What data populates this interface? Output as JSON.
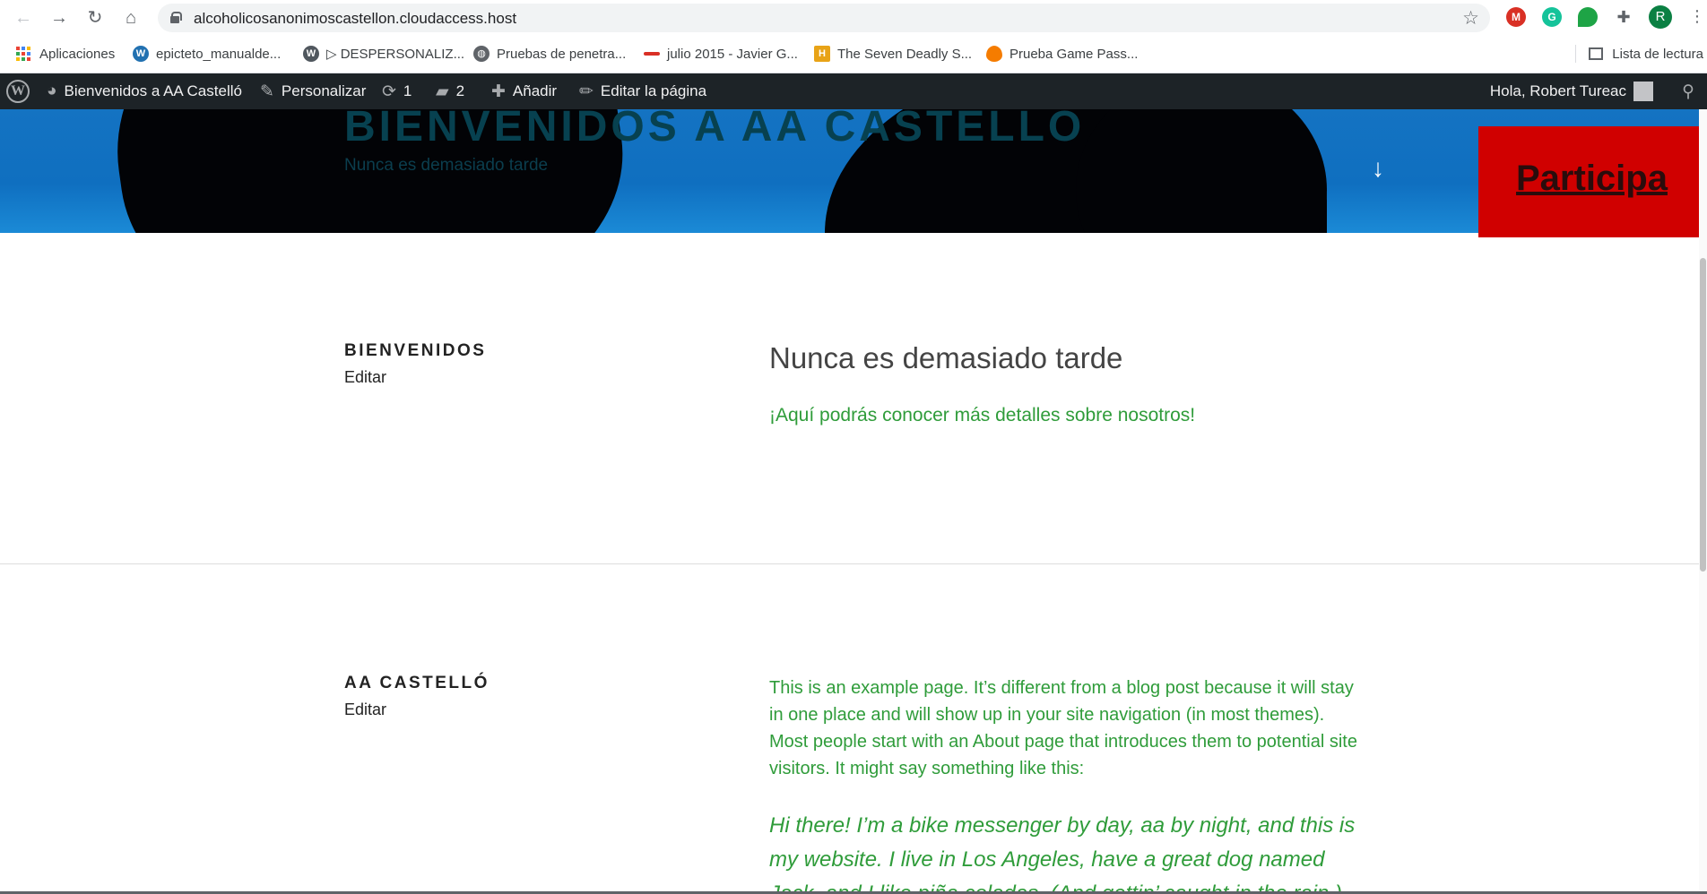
{
  "browser": {
    "url": "alcoholicosanonimoscastellon.cloudaccess.host",
    "profile_initial": "R",
    "bookmarks": [
      {
        "label": "Aplicaciones",
        "icon": "apps-grid-icon"
      },
      {
        "label": "epicteto_manualde...",
        "icon": "wordpress-icon"
      },
      {
        "label": "▷ DESPERSONALIZ...",
        "icon": "wordpress-icon"
      },
      {
        "label": "Pruebas de penetra...",
        "icon": "globe-icon"
      },
      {
        "label": "julio 2015 - Javier G...",
        "icon": "marca-icon"
      },
      {
        "label": "The Seven Deadly S...",
        "icon": "history-icon"
      },
      {
        "label": "Prueba Game Pass...",
        "icon": "fire-icon"
      }
    ],
    "reading_list": "Lista de lectura",
    "extensions": [
      {
        "name": "mcafee-extension-icon",
        "color": "#d93025"
      },
      {
        "name": "grammarly-extension-icon",
        "color": "#15c39a"
      },
      {
        "name": "green-dot-extension-icon",
        "color": "#1ea446"
      },
      {
        "name": "puzzle-extensions-icon",
        "color": "#5f6368"
      }
    ]
  },
  "adminbar": {
    "site_name": "Bienvenidos a AA Castelló",
    "customize": "Personalizar",
    "updates": "1",
    "comments": "2",
    "add_new": "Añadir",
    "edit_page": "Editar la página",
    "greeting": "Hola, Robert Tureac"
  },
  "hero": {
    "site_title": "BIENVENIDOS A AA CASTELLÓ",
    "site_description": "Nunca es demasiado tarde",
    "cta_label": "Participa"
  },
  "sections": [
    {
      "title": "BIENVENIDOS",
      "edit": "Editar",
      "heading": "Nunca es demasiado tarde",
      "lead": "¡Aquí podrás conocer más detalles sobre nosotros!"
    },
    {
      "title": "AA CASTELLÓ",
      "edit": "Editar",
      "paragraph": "This is an example page. It’s different from a blog post because it will stay in one place and will show up in your site navigation (in most themes). Most people start with an About page that introduces them to potential site visitors. It might say something like this:",
      "quote": "Hi there! I’m a bike messenger by day, aa by night, and this is my website. I live in Los Angeles, have a great dog named Jack, and I like piña coladas. (And gettin’ caught in the rain.)"
    }
  ],
  "colors": {
    "adminbar_bg": "#1d2327",
    "accent_green": "#2f9c3a",
    "cta_red": "#d00000"
  }
}
